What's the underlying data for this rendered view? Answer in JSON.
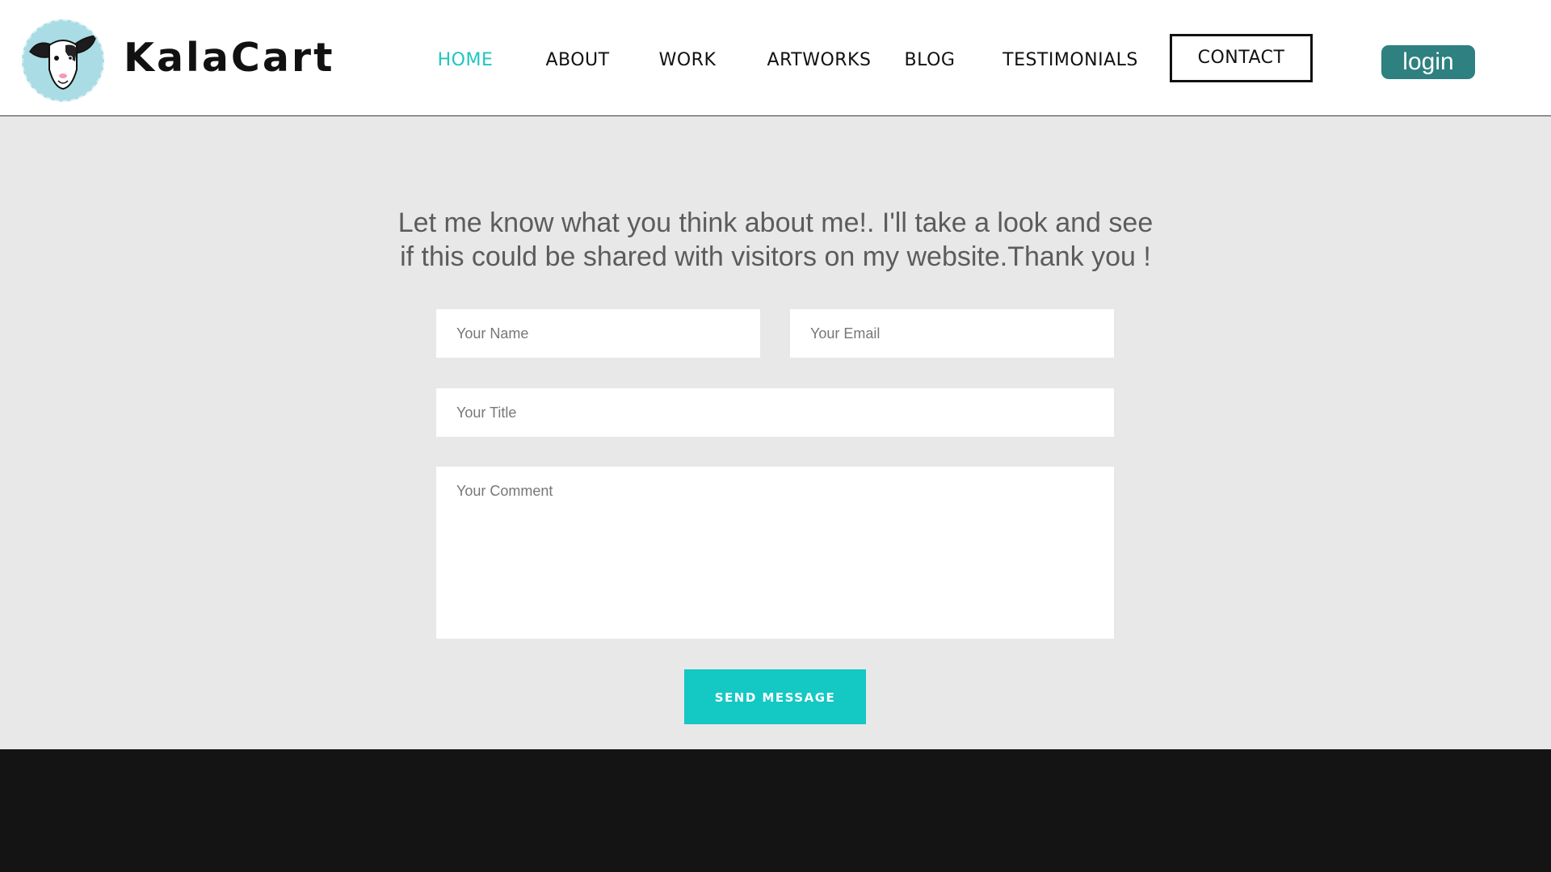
{
  "header": {
    "brand_name": "KalaCart",
    "logo_icon": "goat-mascot-logo",
    "nav": [
      {
        "label": "HOME",
        "active": true
      },
      {
        "label": "ABOUT",
        "active": false
      },
      {
        "label": "WORK",
        "active": false
      },
      {
        "label": "ARTWORKS",
        "active": false
      },
      {
        "label": "BLOG",
        "active": false
      },
      {
        "label": "TESTIMONIALS",
        "active": false
      }
    ],
    "contact_label": "CONTACT",
    "login_label": "login"
  },
  "form": {
    "intro_line1": "Let me know what you think about me!. I'll take a look and see",
    "intro_line2": "if this could be shared with visitors on my website.Thank you !",
    "name_placeholder": "Your Name",
    "email_placeholder": "Your Email",
    "title_placeholder": "Your Title",
    "comment_placeholder": "Your Comment",
    "submit_label": "SEND MESSAGE"
  },
  "colors": {
    "accent_teal": "#14c8c4",
    "nav_active": "#1ec6c1",
    "login_bg": "#2f8080",
    "page_bg": "#e8e8e8",
    "footer_bg": "#141414"
  }
}
